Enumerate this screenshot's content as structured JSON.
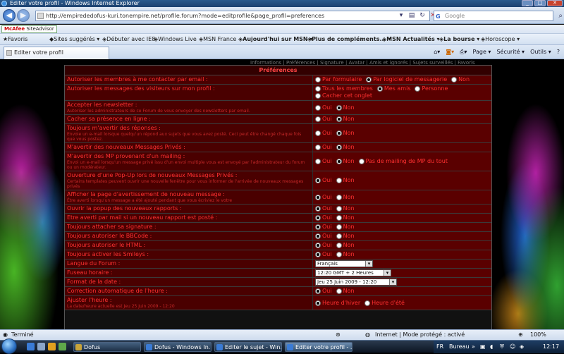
{
  "window": {
    "title": "Editer votre profil - Windows Internet Explorer"
  },
  "address_bar": {
    "url": "http://empirededofus-kuri.tonempire.net/profile.forum?mode=editprofile&page_profil=preferences"
  },
  "search_box": {
    "placeholder": "Google"
  },
  "mcafee": {
    "label": "McAfee",
    "site_advisor": "SiteAdvisor"
  },
  "favorites_bar": [
    "Favoris",
    "Sites suggérés ▾",
    "Débuter avec IE8",
    "Windows Live",
    "MSN France",
    "Aujourd'hui sur MSN ▾",
    "Plus de compléments... ▾",
    "MSN Actualités ▾",
    "La bourse ▾",
    "Horoscope ▾"
  ],
  "tab": {
    "label": "Editer votre profil"
  },
  "command_bar": {
    "page": "Page ▾",
    "securite": "Sécurité ▾",
    "outils": "Outils ▾",
    "help": "?"
  },
  "top_links": "Informations  |  Préférences  |  Signature  |  Avatar  |  Amis et ignorés  |  Sujets surveillés  |  Favoris",
  "panel": {
    "title": "Préférences",
    "rows": [
      {
        "label": "Autoriser les membres à me contacter par email :",
        "desc": "",
        "options": [
          {
            "text": "Par formulaire",
            "on": false
          },
          {
            "text": "Par logiciel de messagerie",
            "on": true
          },
          {
            "text": "Non",
            "on": false
          }
        ]
      },
      {
        "label": "Autoriser les messages des visiteurs sur mon profil :",
        "desc": "",
        "options": [
          {
            "text": "Tous les membres",
            "on": false
          },
          {
            "text": "Mes amis",
            "on": true
          },
          {
            "text": "Personne",
            "on": false
          },
          {
            "text": "Cacher cet onglet",
            "on": false
          }
        ]
      },
      {
        "label": "Accepter les newsletter :",
        "desc": "Autoriser les administrateurs de ce Forum de vous envoyer des newsletters par email.",
        "options": [
          {
            "text": "Oui",
            "on": false
          },
          {
            "text": "Non",
            "on": true
          }
        ]
      },
      {
        "label": "Cacher sa présence en ligne :",
        "desc": "",
        "options": [
          {
            "text": "Oui",
            "on": false
          },
          {
            "text": "Non",
            "on": true
          }
        ]
      },
      {
        "label": "Toujours m'avertir des réponses :",
        "desc": "Envoie un e-mail lorsque quelqu'un répond aux sujets que vous avez posté. Ceci peut être changé chaque fois que vous postez.",
        "options": [
          {
            "text": "Oui",
            "on": false
          },
          {
            "text": "Non",
            "on": true
          }
        ]
      },
      {
        "label": "M'avertir des nouveaux Messages Privés :",
        "desc": "",
        "options": [
          {
            "text": "Oui",
            "on": false
          },
          {
            "text": "Non",
            "on": true
          }
        ]
      },
      {
        "label": "M'avertir des MP provenant d'un mailing :",
        "desc": "Envoi un e-mail lorsqu'un message privé issu d'un envoi multiple vous est envoyé par l'administrateur du forum ou un modérateur.",
        "options": [
          {
            "text": "Oui",
            "on": false
          },
          {
            "text": "Non",
            "on": true
          },
          {
            "text": "Pas de mailing de MP du tout",
            "on": false
          }
        ]
      },
      {
        "label": "Ouverture d'une Pop-Up lors de nouveaux Messages Privés :",
        "desc": "Certains templates peuvent ouvrir une nouvelle fenêtre pour vous informer de l'arrivée de nouveaux messages privés",
        "options": [
          {
            "text": "Oui",
            "on": true
          },
          {
            "text": "Non",
            "on": false
          }
        ]
      },
      {
        "label": "Afficher la page d'avertissement de nouveau message :",
        "desc": "Être averti lorsqu'un message a été ajouté pendant que vous écriviez le votre",
        "options": [
          {
            "text": "Oui",
            "on": true
          },
          {
            "text": "Non",
            "on": false
          }
        ]
      },
      {
        "label": "Ouvrir la popup des nouveaux rapports :",
        "desc": "",
        "options": [
          {
            "text": "Oui",
            "on": true
          },
          {
            "text": "Non",
            "on": false
          }
        ]
      },
      {
        "label": "Etre averti par mail si un nouveau rapport est posté :",
        "desc": "",
        "options": [
          {
            "text": "Oui",
            "on": true
          },
          {
            "text": "Non",
            "on": false
          }
        ]
      },
      {
        "label": "Toujours attacher sa signature :",
        "desc": "",
        "options": [
          {
            "text": "Oui",
            "on": true
          },
          {
            "text": "Non",
            "on": false
          }
        ]
      },
      {
        "label": "Toujours autoriser le BBCode :",
        "desc": "",
        "options": [
          {
            "text": "Oui",
            "on": true
          },
          {
            "text": "Non",
            "on": false
          }
        ]
      },
      {
        "label": "Toujours autoriser le HTML :",
        "desc": "",
        "options": [
          {
            "text": "Oui",
            "on": true
          },
          {
            "text": "Non",
            "on": false
          }
        ]
      },
      {
        "label": "Toujours activer les Smileys :",
        "desc": "",
        "options": [
          {
            "text": "Oui",
            "on": true
          },
          {
            "text": "Non",
            "on": false
          }
        ]
      }
    ],
    "langue": {
      "label": "Langue du Forum :",
      "value": "Français"
    },
    "fuseau": {
      "label": "Fuseau horaire :",
      "value": "12:20 GMT + 2 Heures"
    },
    "format": {
      "label": "Format de la date :",
      "value": "Jeu 25 Juin 2009 - 12:20"
    },
    "correction": {
      "label": "Correction automatique de l'heure :",
      "options": [
        {
          "text": "Oui",
          "on": true
        },
        {
          "text": "Non",
          "on": false
        }
      ]
    },
    "ajuster": {
      "label": "Ajuster l'heure :",
      "desc": "La date/heure actuelle est Jeu 25 Juin 2009 - 12:20",
      "options": [
        {
          "text": "Heure d'hiver",
          "on": true
        },
        {
          "text": "Heure d'été",
          "on": false
        }
      ]
    }
  },
  "statusbar": {
    "status": "Terminé",
    "zone": "Internet | Mode protégé : activé",
    "zoom": "100%"
  },
  "taskbar": {
    "items": [
      "Dofus",
      "Dofus - Windows In...",
      "Editer le sujet - Win...",
      "Editer votre profil - ..."
    ],
    "lang": "FR",
    "bureau": "Bureau",
    "clock": "12:17"
  }
}
